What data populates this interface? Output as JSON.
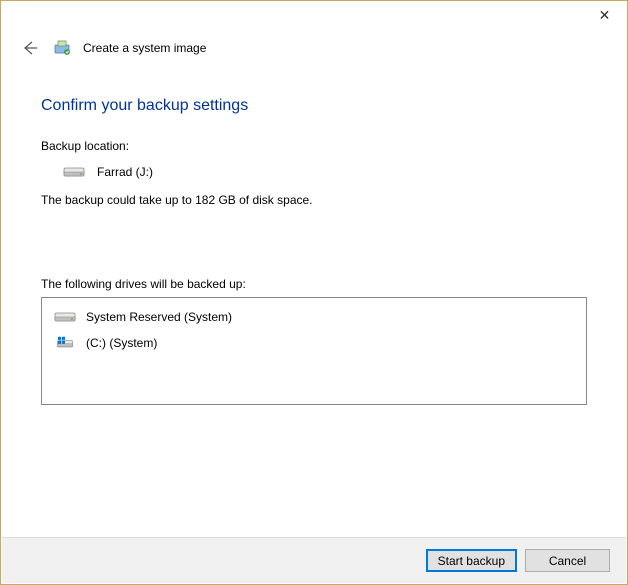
{
  "titlebar": {
    "close_glyph": "✕"
  },
  "header": {
    "back_glyph": "←",
    "title": "Create a system image"
  },
  "main": {
    "heading": "Confirm your backup settings",
    "location_label": "Backup location:",
    "location_name": "Farrad (J:)",
    "estimate_text": "The backup could take up to 182 GB of disk space.",
    "drives_label": "The following drives will be backed up:",
    "drives": [
      {
        "icon": "hdd",
        "name": "System Reserved (System)"
      },
      {
        "icon": "windows-drive",
        "name": "(C:) (System)"
      }
    ]
  },
  "footer": {
    "primary_label": "Start backup",
    "cancel_label": "Cancel"
  }
}
